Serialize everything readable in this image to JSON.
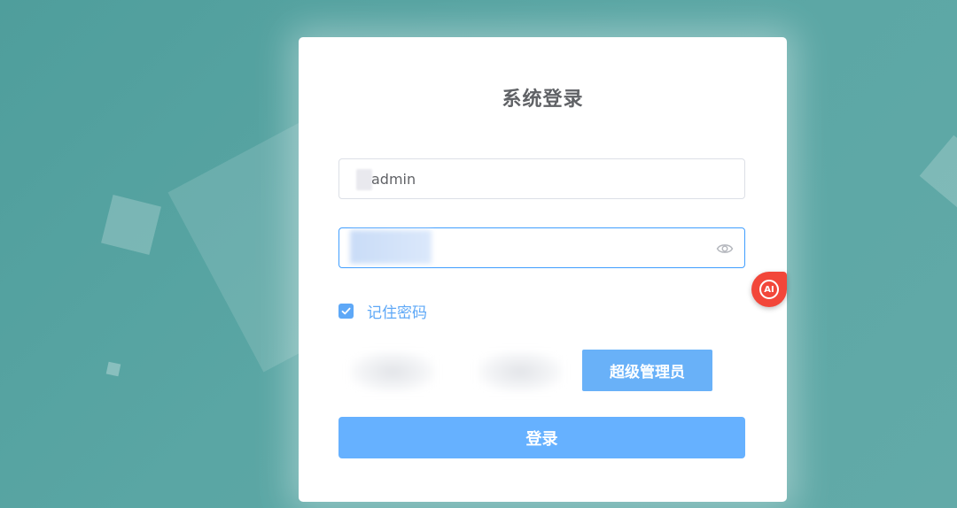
{
  "login": {
    "title": "系统登录",
    "username": {
      "value": "admin",
      "icon": "user-icon"
    },
    "password": {
      "value": "",
      "toggle_icon": "eye-icon"
    },
    "remember": {
      "label": "记住密码",
      "checked": true
    },
    "roles": {
      "selected_label": "超级管理员"
    },
    "submit_label": "登录"
  },
  "assistant": {
    "label": "AI"
  },
  "colors": {
    "background": "#5aa6a4",
    "accent": "#66b1ff",
    "ai_badge": "#f2473a"
  }
}
